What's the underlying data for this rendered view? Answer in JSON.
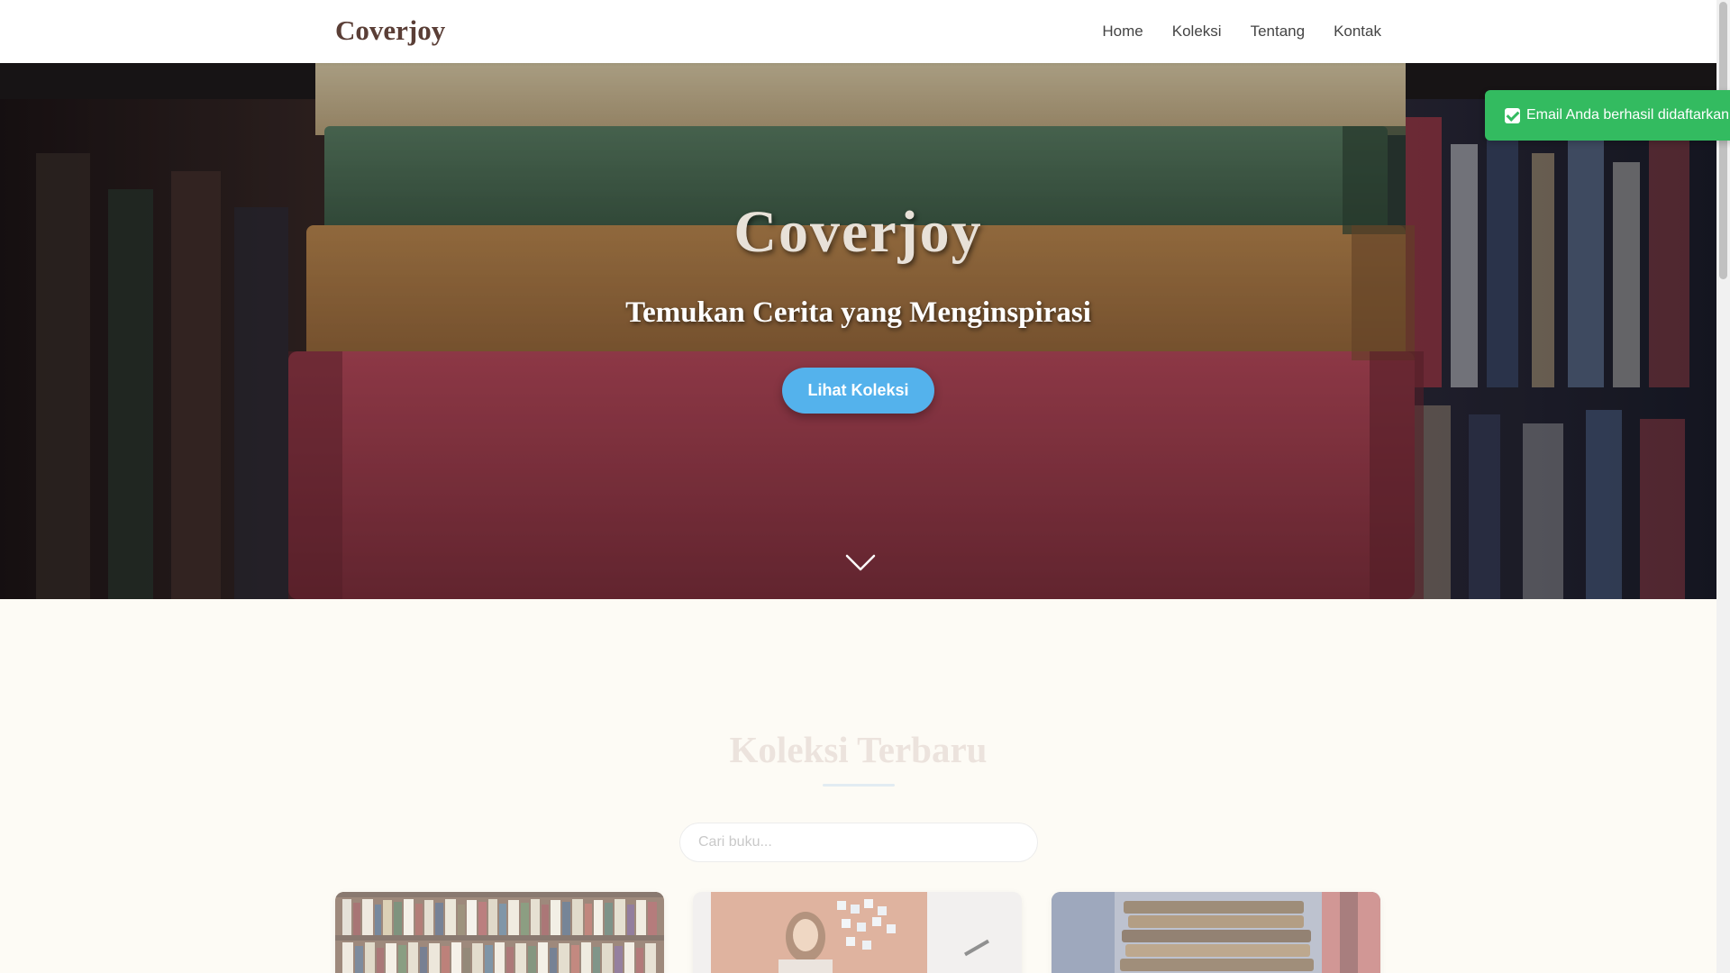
{
  "navbar": {
    "brand": "Coverjoy",
    "links": [
      "Home",
      "Koleksi",
      "Tentang",
      "Kontak"
    ]
  },
  "hero": {
    "title": "Coverjoy",
    "subtitle": "Temukan Cerita yang Menginspirasi",
    "cta_label": "Lihat Koleksi",
    "scroll_icon": "chevron-down-icon"
  },
  "toast": {
    "icon": "check-icon",
    "message": "Email Anda berhasil didaftarkan!"
  },
  "collection": {
    "title": "Koleksi Terbaru",
    "search_placeholder": "Cari buku..."
  },
  "colors": {
    "brand": "#5a3e36",
    "accent_button": "#54b2ec",
    "toast_success": "#33bb60",
    "section_background": "#fdfbf5"
  }
}
